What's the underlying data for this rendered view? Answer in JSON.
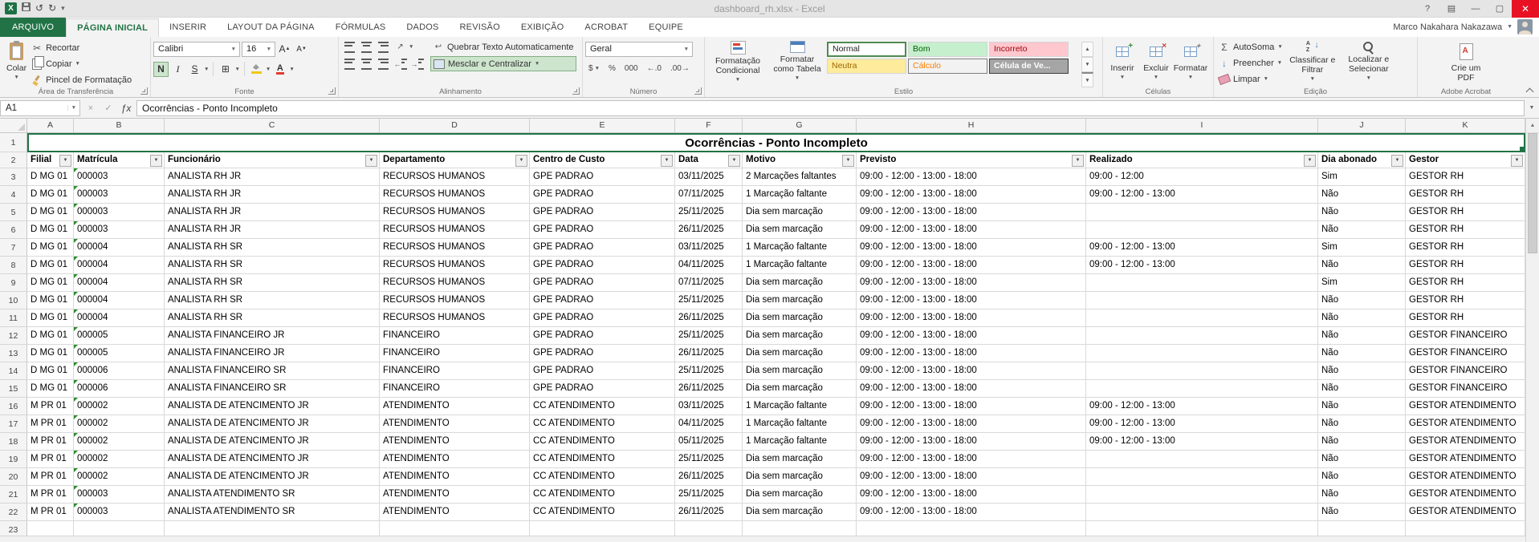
{
  "window": {
    "title": "dashboard_rh.xlsx - Excel",
    "user_name": "Marco Nakahara Nakazawa"
  },
  "tabs": {
    "file": "ARQUIVO",
    "items": [
      "PÁGINA INICIAL",
      "INSERIR",
      "LAYOUT DA PÁGINA",
      "FÓRMULAS",
      "DADOS",
      "REVISÃO",
      "EXIBIÇÃO",
      "ACROBAT",
      "EQUIPE"
    ],
    "active": "PÁGINA INICIAL"
  },
  "ribbon": {
    "clipboard": {
      "group": "Área de Transferência",
      "paste": "Colar",
      "cut": "Recortar",
      "copy": "Copiar",
      "painter": "Pincel de Formatação"
    },
    "font": {
      "group": "Fonte",
      "family": "Calibri",
      "size": "16",
      "bold": "N",
      "italic": "I",
      "underline": "S"
    },
    "alignment": {
      "group": "Alinhamento",
      "wrap": "Quebrar Texto Automaticamente",
      "merge": "Mesclar e Centralizar"
    },
    "number": {
      "group": "Número",
      "format": "Geral",
      "thousands": "000",
      "percent": "%",
      "currency": "$"
    },
    "styles": {
      "group": "Estilo",
      "conditional": "Formatação Condicional",
      "as_table": "Formatar como Tabela",
      "gallery": [
        "Normal",
        "Bom",
        "Incorreto",
        "Neutra",
        "Cálculo",
        "Célula de Ve..."
      ]
    },
    "cells": {
      "group": "Células",
      "insert": "Inserir",
      "delete": "Excluir",
      "format": "Formatar"
    },
    "editing": {
      "group": "Edição",
      "autosum": "AutoSoma",
      "fill": "Preencher",
      "clear": "Limpar",
      "sort": "Classificar e Filtrar",
      "find": "Localizar e Selecionar"
    },
    "acrobat": {
      "group": "Adobe Acrobat",
      "create": "Crie um PDF"
    }
  },
  "formula_bar": {
    "cell_ref": "A1",
    "value": "Ocorrências - Ponto Incompleto"
  },
  "sheet": {
    "title": "Ocorrências - Ponto Incompleto",
    "col_letters": [
      "A",
      "B",
      "C",
      "D",
      "E",
      "F",
      "G",
      "H",
      "I",
      "J",
      "K"
    ],
    "headers": [
      "Filial",
      "Matrícula",
      "Funcionário",
      "Departamento",
      "Centro de Custo",
      "Data",
      "Motivo",
      "Previsto",
      "Realizado",
      "Dia abonado",
      "Gestor"
    ],
    "rows": [
      [
        "D MG 01",
        "000003",
        "ANALISTA RH JR",
        "RECURSOS HUMANOS",
        "GPE PADRAO",
        "03/11/2025",
        "2 Marcações faltantes",
        "09:00 - 12:00 - 13:00 - 18:00",
        "09:00 - 12:00",
        "Sim",
        "GESTOR RH"
      ],
      [
        "D MG 01",
        "000003",
        "ANALISTA RH JR",
        "RECURSOS HUMANOS",
        "GPE PADRAO",
        "07/11/2025",
        "1 Marcação faltante",
        "09:00 - 12:00 - 13:00 - 18:00",
        "09:00 - 12:00 - 13:00",
        "Não",
        "GESTOR RH"
      ],
      [
        "D MG 01",
        "000003",
        "ANALISTA RH JR",
        "RECURSOS HUMANOS",
        "GPE PADRAO",
        "25/11/2025",
        "Dia sem marcação",
        "09:00 - 12:00 - 13:00 - 18:00",
        "",
        "Não",
        "GESTOR RH"
      ],
      [
        "D MG 01",
        "000003",
        "ANALISTA RH JR",
        "RECURSOS HUMANOS",
        "GPE PADRAO",
        "26/11/2025",
        "Dia sem marcação",
        "09:00 - 12:00 - 13:00 - 18:00",
        "",
        "Não",
        "GESTOR RH"
      ],
      [
        "D MG 01",
        "000004",
        "ANALISTA RH SR",
        "RECURSOS HUMANOS",
        "GPE PADRAO",
        "03/11/2025",
        "1 Marcação faltante",
        "09:00 - 12:00 - 13:00 - 18:00",
        "09:00 - 12:00 - 13:00",
        "Sim",
        "GESTOR RH"
      ],
      [
        "D MG 01",
        "000004",
        "ANALISTA RH SR",
        "RECURSOS HUMANOS",
        "GPE PADRAO",
        "04/11/2025",
        "1 Marcação faltante",
        "09:00 - 12:00 - 13:00 - 18:00",
        "09:00 - 12:00 - 13:00",
        "Não",
        "GESTOR RH"
      ],
      [
        "D MG 01",
        "000004",
        "ANALISTA RH SR",
        "RECURSOS HUMANOS",
        "GPE PADRAO",
        "07/11/2025",
        "Dia sem marcação",
        "09:00 - 12:00 - 13:00 - 18:00",
        "",
        "Sim",
        "GESTOR RH"
      ],
      [
        "D MG 01",
        "000004",
        "ANALISTA RH SR",
        "RECURSOS HUMANOS",
        "GPE PADRAO",
        "25/11/2025",
        "Dia sem marcação",
        "09:00 - 12:00 - 13:00 - 18:00",
        "",
        "Não",
        "GESTOR RH"
      ],
      [
        "D MG 01",
        "000004",
        "ANALISTA RH SR",
        "RECURSOS HUMANOS",
        "GPE PADRAO",
        "26/11/2025",
        "Dia sem marcação",
        "09:00 - 12:00 - 13:00 - 18:00",
        "",
        "Não",
        "GESTOR RH"
      ],
      [
        "D MG 01",
        "000005",
        "ANALISTA FINANCEIRO JR",
        "FINANCEIRO",
        "GPE PADRAO",
        "25/11/2025",
        "Dia sem marcação",
        "09:00 - 12:00 - 13:00 - 18:00",
        "",
        "Não",
        "GESTOR FINANCEIRO"
      ],
      [
        "D MG 01",
        "000005",
        "ANALISTA FINANCEIRO JR",
        "FINANCEIRO",
        "GPE PADRAO",
        "26/11/2025",
        "Dia sem marcação",
        "09:00 - 12:00 - 13:00 - 18:00",
        "",
        "Não",
        "GESTOR FINANCEIRO"
      ],
      [
        "D MG 01",
        "000006",
        "ANALISTA FINANCEIRO SR",
        "FINANCEIRO",
        "GPE PADRAO",
        "25/11/2025",
        "Dia sem marcação",
        "09:00 - 12:00 - 13:00 - 18:00",
        "",
        "Não",
        "GESTOR FINANCEIRO"
      ],
      [
        "D MG 01",
        "000006",
        "ANALISTA FINANCEIRO SR",
        "FINANCEIRO",
        "GPE PADRAO",
        "26/11/2025",
        "Dia sem marcação",
        "09:00 - 12:00 - 13:00 - 18:00",
        "",
        "Não",
        "GESTOR FINANCEIRO"
      ],
      [
        "M PR 01",
        "000002",
        "ANALISTA DE ATENCIMENTO JR",
        "ATENDIMENTO",
        "CC ATENDIMENTO",
        "03/11/2025",
        "1 Marcação faltante",
        "09:00 - 12:00 - 13:00 - 18:00",
        "09:00 - 12:00 - 13:00",
        "Não",
        "GESTOR ATENDIMENTO"
      ],
      [
        "M PR 01",
        "000002",
        "ANALISTA DE ATENCIMENTO JR",
        "ATENDIMENTO",
        "CC ATENDIMENTO",
        "04/11/2025",
        "1 Marcação faltante",
        "09:00 - 12:00 - 13:00 - 18:00",
        "09:00 - 12:00 - 13:00",
        "Não",
        "GESTOR ATENDIMENTO"
      ],
      [
        "M PR 01",
        "000002",
        "ANALISTA DE ATENCIMENTO JR",
        "ATENDIMENTO",
        "CC ATENDIMENTO",
        "05/11/2025",
        "1 Marcação faltante",
        "09:00 - 12:00 - 13:00 - 18:00",
        "09:00 - 12:00 - 13:00",
        "Não",
        "GESTOR ATENDIMENTO"
      ],
      [
        "M PR 01",
        "000002",
        "ANALISTA DE ATENCIMENTO JR",
        "ATENDIMENTO",
        "CC ATENDIMENTO",
        "25/11/2025",
        "Dia sem marcação",
        "09:00 - 12:00 - 13:00 - 18:00",
        "",
        "Não",
        "GESTOR ATENDIMENTO"
      ],
      [
        "M PR 01",
        "000002",
        "ANALISTA DE ATENCIMENTO JR",
        "ATENDIMENTO",
        "CC ATENDIMENTO",
        "26/11/2025",
        "Dia sem marcação",
        "09:00 - 12:00 - 13:00 - 18:00",
        "",
        "Não",
        "GESTOR ATENDIMENTO"
      ],
      [
        "M PR 01",
        "000003",
        "ANALISTA ATENDIMENTO SR",
        "ATENDIMENTO",
        "CC ATENDIMENTO",
        "25/11/2025",
        "Dia sem marcação",
        "09:00 - 12:00 - 13:00 - 18:00",
        "",
        "Não",
        "GESTOR ATENDIMENTO"
      ],
      [
        "M PR 01",
        "000003",
        "ANALISTA ATENDIMENTO SR",
        "ATENDIMENTO",
        "CC ATENDIMENTO",
        "26/11/2025",
        "Dia sem marcação",
        "09:00 - 12:00 - 13:00 - 18:00",
        "",
        "Não",
        "GESTOR ATENDIMENTO"
      ]
    ],
    "last_visible_row_number": 23
  },
  "colors": {
    "accent_green": "#217346",
    "style_bom_bg": "#c6efce",
    "style_incorreto_bg": "#ffc7ce",
    "style_neutra_bg": "#ffeb9c",
    "style_calculo_text": "#fa7d00",
    "close_button_red": "#e81123"
  }
}
